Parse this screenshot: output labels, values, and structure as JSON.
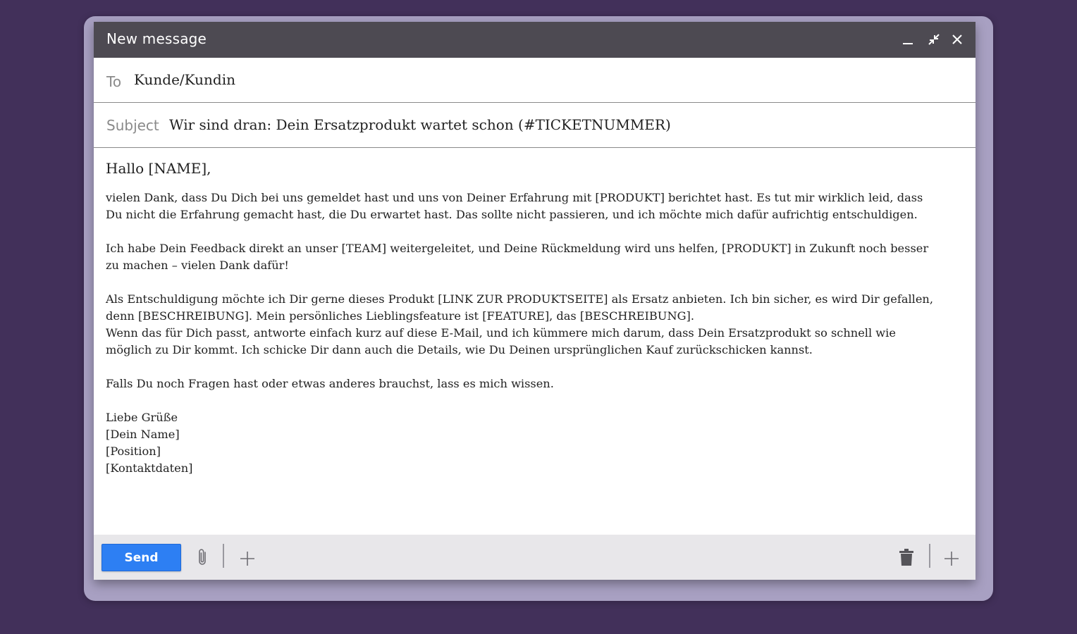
{
  "window": {
    "title": "New message"
  },
  "titlebar": {
    "minimize_icon": "minimize-icon",
    "collapse_icon": "collapse-arrows-icon",
    "close_icon": "close-icon"
  },
  "to": {
    "label": "To",
    "value": "Kunde/Kundin"
  },
  "subject": {
    "label": "Subject",
    "value": "Wir sind dran: Dein Ersatzprodukt wartet schon (#TICKETNUMMER)"
  },
  "body": {
    "greeting": "Hallo [NAME],",
    "p1_line1": "vielen Dank, dass Du Dich bei uns gemeldet hast und uns von Deiner Erfahrung mit [PRODUKT] berichtet hast. Es tut mir wirklich leid, dass",
    "p1_line2": "Du nicht die Erfahrung gemacht hast, die Du erwartet hast. Das sollte nicht passieren, und ich möchte mich dafür aufrichtig entschuldigen.",
    "p2_line1": "Ich habe Dein Feedback direkt an unser [TEAM] weitergeleitet, und Deine Rückmeldung wird uns helfen, [PRODUKT] in Zukunft noch besser",
    "p2_line2": "zu machen – vielen Dank dafür!",
    "p3_line1": "Als Entschuldigung möchte ich Dir gerne dieses Produkt [LINK ZUR PRODUKTSEITE] als Ersatz anbieten. Ich bin sicher, es wird Dir gefallen,",
    "p3_line2": "denn [BESCHREIBUNG]. Mein persönliches Lieblingsfeature ist [FEATURE], das [BESCHREIBUNG].",
    "p3_line3": "Wenn das für Dich passt, antworte einfach kurz auf diese E-Mail, und ich kümmere mich darum, dass Dein Ersatzprodukt so schnell wie",
    "p3_line4": "möglich zu Dir kommt. Ich schicke Dir dann auch die Details, wie Du Deinen ursprünglichen Kauf zurückschicken kannst.",
    "p4_line1": "Falls Du noch Fragen hast oder etwas anderes brauchst, lass es mich wissen.",
    "closing": "Liebe Grüße",
    "sig_name": "[Dein Name]",
    "sig_position": "[Position]",
    "sig_contact": "[Kontaktdaten]"
  },
  "toolbar": {
    "send_label": "Send",
    "attach_icon": "paperclip-icon",
    "add_icon": "plus-icon",
    "delete_icon": "trash-icon",
    "more_icon": "plus-icon"
  },
  "colors": {
    "background": "#42305a",
    "frame": "#a8a0c2",
    "titlebar": "#4d4a52",
    "send_button": "#2d7ff3",
    "toolbar": "#e8e7ea"
  }
}
